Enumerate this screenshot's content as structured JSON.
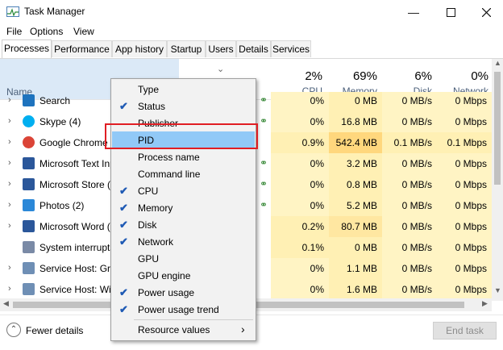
{
  "window": {
    "title": "Task Manager"
  },
  "menubar": [
    "File",
    "Options",
    "View"
  ],
  "tabs": [
    "Processes",
    "Performance",
    "App history",
    "Startup",
    "Users",
    "Details",
    "Services"
  ],
  "header": {
    "name_label": "Name",
    "columns": [
      {
        "pct": "2%",
        "name": "CPU"
      },
      {
        "pct": "69%",
        "name": "Memory"
      },
      {
        "pct": "6%",
        "name": "Disk"
      },
      {
        "pct": "0%",
        "name": "Network"
      }
    ]
  },
  "rows": [
    {
      "name": "Search",
      "cpu": "0%",
      "mem": "0 MB",
      "disk": "0 MB/s",
      "net": "0 Mbps",
      "icon_color": "#1e73be",
      "leaf": true
    },
    {
      "name": "Skype (4)",
      "cpu": "0%",
      "mem": "16.8 MB",
      "disk": "0 MB/s",
      "net": "0 Mbps",
      "icon_color": "#00aff0",
      "leaf": true
    },
    {
      "name": "Google Chrome (1",
      "cpu": "0.9%",
      "mem": "542.4 MB",
      "disk": "0.1 MB/s",
      "net": "0.1 Mbps",
      "icon_color": "#db4437",
      "leaf": false
    },
    {
      "name": "Microsoft Text Inp",
      "cpu": "0%",
      "mem": "3.2 MB",
      "disk": "0 MB/s",
      "net": "0 Mbps",
      "icon_color": "#2b579a",
      "leaf": true
    },
    {
      "name": "Microsoft Store (2",
      "cpu": "0%",
      "mem": "0.8 MB",
      "disk": "0 MB/s",
      "net": "0 Mbps",
      "icon_color": "#2b579a",
      "leaf": true
    },
    {
      "name": "Photos (2)",
      "cpu": "0%",
      "mem": "5.2 MB",
      "disk": "0 MB/s",
      "net": "0 Mbps",
      "icon_color": "#2b88d8",
      "leaf": true
    },
    {
      "name": "Microsoft Word (3",
      "cpu": "0.2%",
      "mem": "80.7 MB",
      "disk": "0 MB/s",
      "net": "0 Mbps",
      "icon_color": "#2b579a",
      "leaf": false
    },
    {
      "name": "System interrupts",
      "cpu": "0.1%",
      "mem": "0 MB",
      "disk": "0 MB/s",
      "net": "0 Mbps",
      "icon_color": "#7a8aa6",
      "leaf": false
    },
    {
      "name": "Service Host: Grou",
      "cpu": "0%",
      "mem": "1.1 MB",
      "disk": "0 MB/s",
      "net": "0 Mbps",
      "icon_color": "#6f8fb5",
      "leaf": false
    },
    {
      "name": "Service Host: Wind",
      "cpu": "0%",
      "mem": "1.6 MB",
      "disk": "0 MB/s",
      "net": "0 Mbps",
      "icon_color": "#6f8fb5",
      "leaf": false
    }
  ],
  "context_menu": [
    {
      "label": "Type",
      "checked": false
    },
    {
      "label": "Status",
      "checked": true
    },
    {
      "label": "Publisher",
      "checked": false
    },
    {
      "label": "PID",
      "checked": false,
      "highlighted": true
    },
    {
      "label": "Process name",
      "checked": false
    },
    {
      "label": "Command line",
      "checked": false
    },
    {
      "label": "CPU",
      "checked": true
    },
    {
      "label": "Memory",
      "checked": true
    },
    {
      "label": "Disk",
      "checked": true
    },
    {
      "label": "Network",
      "checked": true
    },
    {
      "label": "GPU",
      "checked": false
    },
    {
      "label": "GPU engine",
      "checked": false
    },
    {
      "label": "Power usage",
      "checked": true
    },
    {
      "label": "Power usage trend",
      "checked": true
    }
  ],
  "context_submenu": {
    "label": "Resource values",
    "arrow": "›"
  },
  "footer": {
    "fewer_details": "Fewer details",
    "end_task": "End task"
  },
  "colors": {
    "highlight": "#91c9f7",
    "redbox": "#e01e24",
    "heat_light": "#fff4c4",
    "heat_mid": "#fff0b4",
    "heat_strong": "#ffd77d"
  }
}
